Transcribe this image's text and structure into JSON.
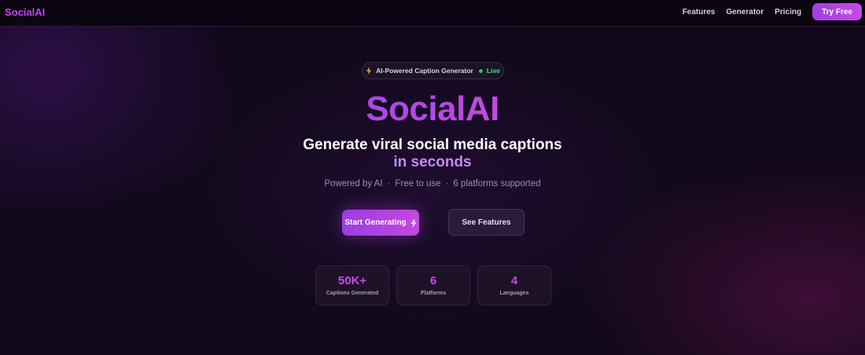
{
  "nav": {
    "logo": "SocialAI",
    "links": [
      "Features",
      "Generator",
      "Pricing"
    ],
    "cta": "Try Free"
  },
  "badge": {
    "icon": "bolt-icon",
    "text": "AI-Powered Caption Generator",
    "status": "Live",
    "status_color": "#22c55e"
  },
  "hero": {
    "title": "SocialAI",
    "subtitle_line1": "Generate viral social media captions",
    "subtitle_line2": "in seconds",
    "tagline": [
      "Powered by AI",
      "Free to use",
      "6 platforms supported"
    ],
    "tagline_separator": "·"
  },
  "buttons": {
    "primary": "Start Generating",
    "secondary": "See Features"
  },
  "stats": [
    {
      "value": "50K+",
      "label": "Captions Generated"
    },
    {
      "value": "6",
      "label": "Platforms"
    },
    {
      "value": "4",
      "label": "Languages"
    }
  ],
  "colors": {
    "accent": "#b046e6",
    "background": "#0f0818",
    "live": "#22c55e"
  }
}
